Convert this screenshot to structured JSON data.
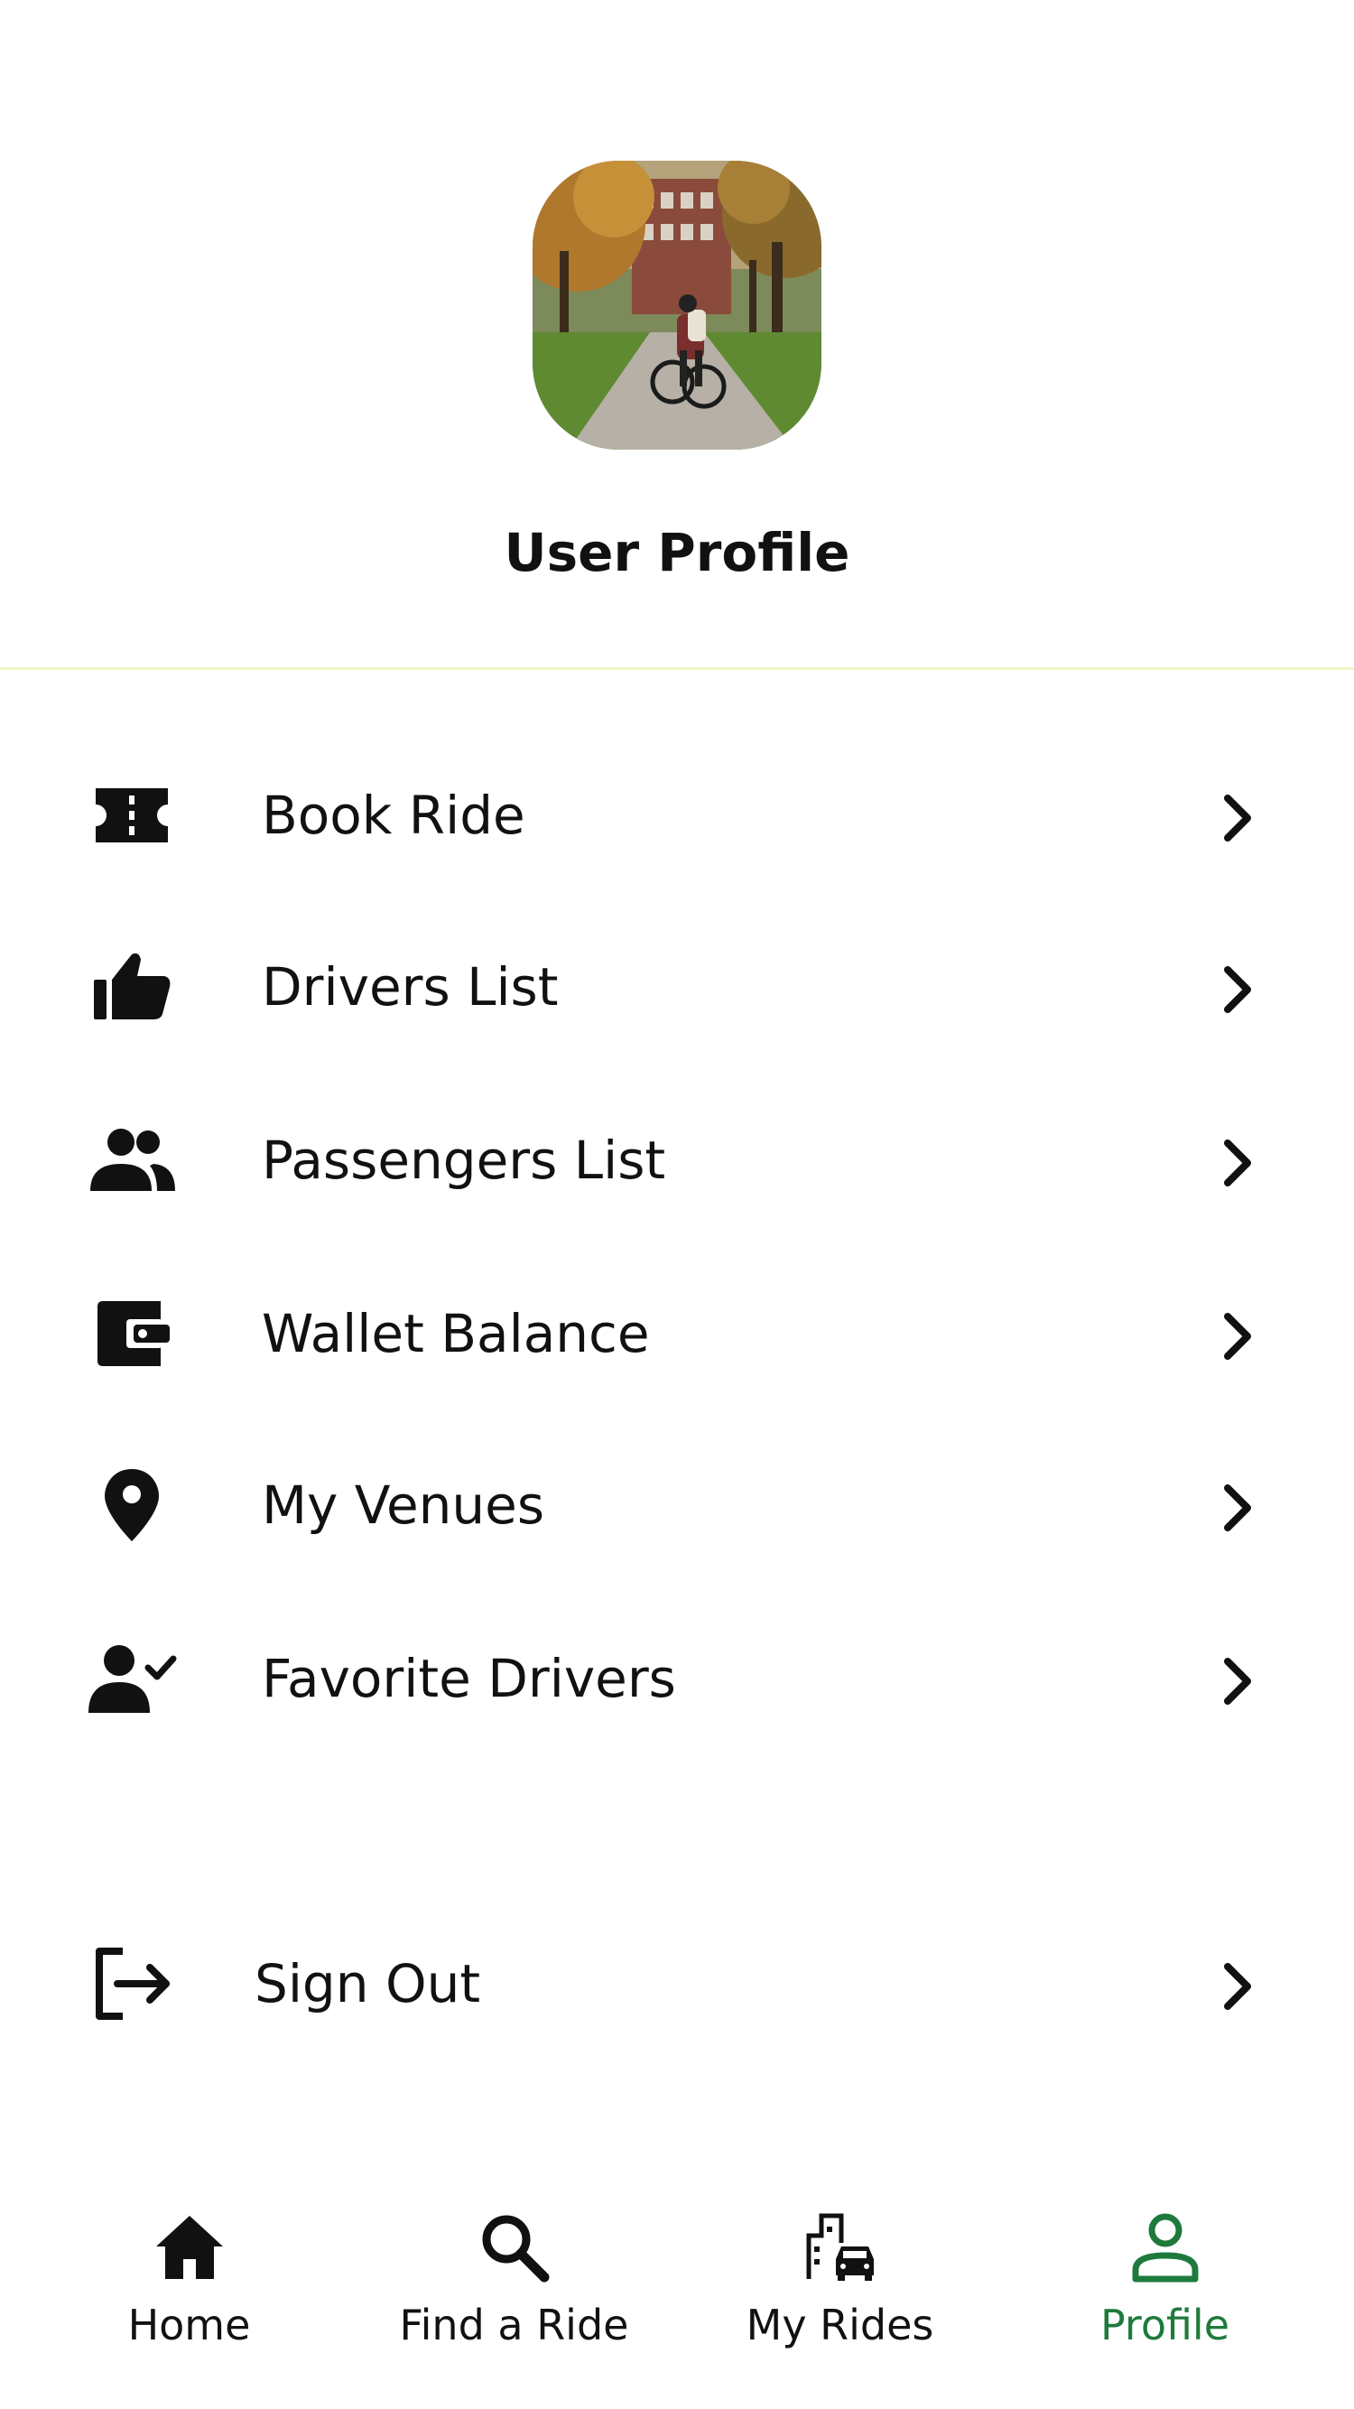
{
  "header": {
    "title": "User Profile",
    "divider_color": "#eef7c6"
  },
  "menu": {
    "items": [
      {
        "label": "Book Ride",
        "icon": "ticket-icon"
      },
      {
        "label": "Drivers List",
        "icon": "thumbs-up-icon"
      },
      {
        "label": "Passengers List",
        "icon": "people-icon"
      },
      {
        "label": "Wallet Balance",
        "icon": "wallet-icon"
      },
      {
        "label": "My Venues",
        "icon": "location-pin-icon"
      },
      {
        "label": "Favorite Drivers",
        "icon": "person-check-icon"
      }
    ],
    "sign_out": {
      "label": "Sign Out",
      "icon": "logout-icon"
    }
  },
  "bottom_nav": {
    "items": [
      {
        "label": "Home",
        "icon": "home-icon",
        "active": false
      },
      {
        "label": "Find a Ride",
        "icon": "search-icon",
        "active": false
      },
      {
        "label": "My Rides",
        "icon": "city-car-icon",
        "active": false
      },
      {
        "label": "Profile",
        "icon": "person-outline-icon",
        "active": true
      }
    ],
    "active_color": "#1e7a3c"
  }
}
